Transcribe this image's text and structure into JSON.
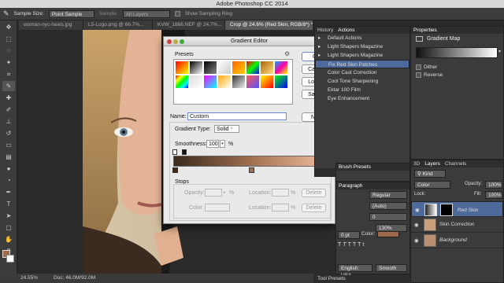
{
  "app": {
    "title": "Adobe Photoshop CC 2014"
  },
  "options_bar": {
    "sample_size_label": "Sample Size:",
    "sample_size_value": "Point Sample",
    "sample_label": "Sample:",
    "sample_value": "All Layers",
    "show_ring_label": "Show Sampling Ring"
  },
  "tabs": [
    {
      "label": "woman-nyc-heels.jpg"
    },
    {
      "label": "L5-Logo.png @ 66.7%..."
    },
    {
      "label": "KVW_1866.NEF @ 24.7%..."
    },
    {
      "label": "Crop @ 24.6% (Red Skin, RGB/8*) *"
    }
  ],
  "status_bar": {
    "zoom": "24.55%",
    "doc": "Doc: 46.0M/92.0M"
  },
  "gradient_editor": {
    "title": "Gradient Editor",
    "presets_label": "Presets",
    "buttons": {
      "ok": "OK",
      "cancel": "Cancel",
      "load": "Load...",
      "save": "Save...",
      "new": "New"
    },
    "name_label": "Name:",
    "name_value": "Custom",
    "gradient_type_label": "Gradient Type:",
    "gradient_type_value": "Solid",
    "smoothness_label": "Smoothness:",
    "smoothness_value": "100",
    "smoothness_unit": "%",
    "stops_label": "Stops",
    "opacity_label": "Opacity:",
    "opacity_unit": "%",
    "location_label": "Location:",
    "location_unit": "%",
    "color_label": "Color:",
    "delete_label": "Delete",
    "gradient_start_color": "#3a2a1c",
    "gradient_mid_color": "#a07050",
    "gradient_end_color": "#f0c0a0"
  },
  "history_panel": {
    "tabs": [
      "History",
      "Actions"
    ],
    "items": [
      "Default Actions",
      "Light Shapers Magazine",
      "Light Shapers Magazine",
      "Fix Red Skin Patches",
      "Color Cast Correction",
      "Cool Tone Sharpening",
      "Ektar 100 Film",
      "Eye Enhancement"
    ],
    "selected_index": 3
  },
  "properties_panel": {
    "title": "Properties",
    "adjustment": "Gradient Map",
    "dither_label": "Dither",
    "reverse_label": "Reverse"
  },
  "presets_tab": {
    "label": "Brush Presets"
  },
  "paragraph_panel": {
    "title": "Paragraph",
    "font_style": "Regular",
    "leading": "(Auto)",
    "tracking": "0",
    "scale": "130%",
    "color_label": "Color:",
    "language": "English: USA",
    "aa": "Smooth",
    "pt_value": "0 pt"
  },
  "tool_presets": {
    "label": "Tool Presets"
  },
  "layers_panel": {
    "tabs": [
      "3D",
      "Layers",
      "Channels"
    ],
    "kind_label": "Kind",
    "mode_value": "Color",
    "opacity_label": "Opacity:",
    "opacity_value": "100%",
    "fill_label": "Fill:",
    "fill_value": "100%",
    "lock_label": "Lock:",
    "layers": [
      {
        "name": "Red Skin",
        "selected": true
      },
      {
        "name": "Skin Correction",
        "selected": false
      },
      {
        "name": "Background",
        "selected": false,
        "italic": true
      }
    ]
  },
  "colors": {
    "selection_blue": "#4d6a9a",
    "panel_bg": "#3b3b3b",
    "dialog_bg": "#e9e9e9"
  }
}
